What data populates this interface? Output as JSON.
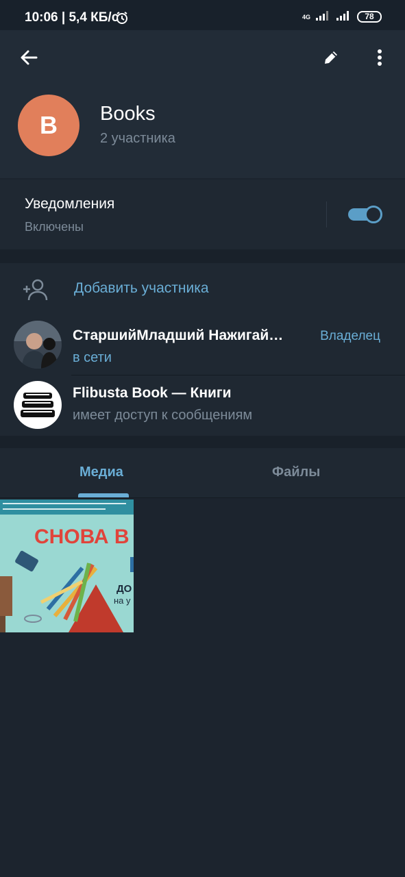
{
  "status_bar": {
    "text": "10:06 | 5,4 КБ/с",
    "network": "4G",
    "battery": "78"
  },
  "header": {
    "avatar_letter": "B",
    "avatar_color": "#e17f5b",
    "title": "Books",
    "subtitle": "2 участника",
    "icons": [
      "back-arrow-icon",
      "pencil-icon",
      "more-vert-icon"
    ]
  },
  "notifications": {
    "title": "Уведомления",
    "status": "Включены",
    "enabled": true
  },
  "members": {
    "add_label": "Добавить участника",
    "list": [
      {
        "name": "СтаршийМладший Нажигай…",
        "status": "в сети",
        "role": "Владелец"
      },
      {
        "name": "Flibusta Book — Книги",
        "status": "имеет доступ к сообщениям",
        "role": ""
      }
    ]
  },
  "tabs": {
    "items": [
      {
        "label": "Медиа",
        "active": true
      },
      {
        "label": "Файлы",
        "active": false
      }
    ]
  },
  "media": {
    "thumb_title": "СНОВА В Ш",
    "thumb_small_1": "ДО",
    "thumb_small_2": "на у"
  },
  "colors": {
    "accent": "#6aaed6",
    "background": "#1c242e",
    "header_bg": "#222c37",
    "secondary_text": "#7d8b99"
  }
}
